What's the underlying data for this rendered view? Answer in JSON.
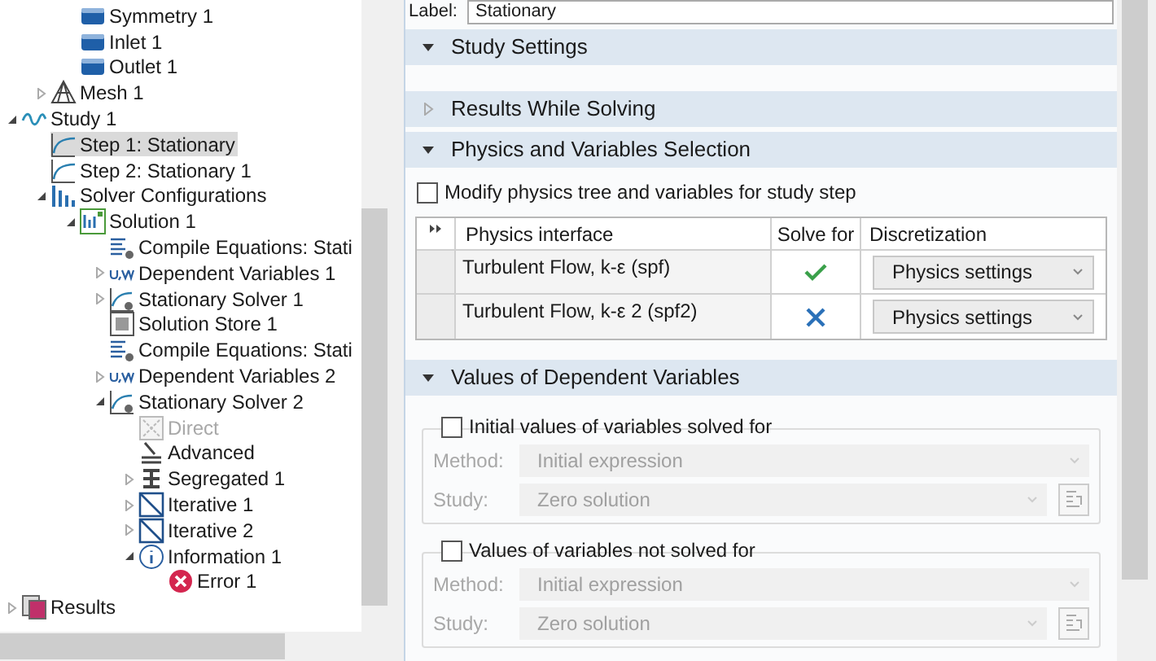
{
  "tree": [
    {
      "children": [
        {
          "children": [
            {
              "label": "Symmetry 1",
              "kind": "boundary",
              "selected": false,
              "disabled": false
            },
            {
              "label": "Inlet 1",
              "kind": "boundary",
              "selected": false,
              "disabled": false
            },
            {
              "label": "Outlet 1",
              "kind": "boundary",
              "selected": false,
              "disabled": false
            }
          ]
        },
        {
          "label": "Mesh 1",
          "kind": "mesh",
          "expanded": false,
          "selected": false,
          "disabled": false
        }
      ]
    },
    {
      "label": "Study 1",
      "kind": "study",
      "expanded": true,
      "selected": false,
      "disabled": false,
      "children": [
        {
          "label": "Step 1: Stationary",
          "kind": "step",
          "selected": true,
          "disabled": false
        },
        {
          "label": "Step 2: Stationary 1",
          "kind": "step",
          "selected": false,
          "disabled": false
        },
        {
          "label": "Solver Configurations",
          "kind": "solver-config",
          "expanded": true,
          "selected": false,
          "disabled": false,
          "children": [
            {
              "label": "Solution 1",
              "kind": "solution",
              "expanded": true,
              "selected": false,
              "disabled": false,
              "children": [
                {
                  "label": "Compile Equations: Stati",
                  "kind": "compile",
                  "selected": false,
                  "disabled": false
                },
                {
                  "label": "Dependent Variables 1",
                  "kind": "variables",
                  "expanded": false,
                  "selected": false,
                  "disabled": false
                },
                {
                  "label": "Stationary Solver 1",
                  "kind": "solver",
                  "expanded": false,
                  "selected": false,
                  "disabled": false
                },
                {
                  "label": "Solution Store 1",
                  "kind": "store",
                  "selected": false,
                  "disabled": false
                },
                {
                  "label": "Compile Equations: Stati",
                  "kind": "compile",
                  "selected": false,
                  "disabled": false
                },
                {
                  "label": "Dependent Variables 2",
                  "kind": "variables",
                  "expanded": false,
                  "selected": false,
                  "disabled": false
                },
                {
                  "label": "Stationary Solver 2",
                  "kind": "solver",
                  "expanded": true,
                  "selected": false,
                  "disabled": false,
                  "children": [
                    {
                      "label": "Direct",
                      "kind": "direct",
                      "selected": false,
                      "disabled": true
                    },
                    {
                      "label": "Advanced",
                      "kind": "advanced",
                      "selected": false,
                      "disabled": false
                    },
                    {
                      "label": "Segregated 1",
                      "kind": "segregated",
                      "expanded": false,
                      "selected": false,
                      "disabled": false
                    },
                    {
                      "label": "Iterative 1",
                      "kind": "iterative",
                      "expanded": false,
                      "selected": false,
                      "disabled": false
                    },
                    {
                      "label": "Iterative 2",
                      "kind": "iterative",
                      "expanded": false,
                      "selected": false,
                      "disabled": false
                    },
                    {
                      "label": "Information 1",
                      "kind": "information",
                      "expanded": true,
                      "selected": false,
                      "disabled": false,
                      "children": [
                        {
                          "label": "Error 1",
                          "kind": "error",
                          "selected": false,
                          "disabled": false
                        }
                      ]
                    }
                  ]
                }
              ]
            }
          ]
        }
      ]
    },
    {
      "label": "Results",
      "kind": "results",
      "expanded": false,
      "selected": false,
      "disabled": false
    }
  ],
  "settings": {
    "label_caption": "Label:",
    "label_value": "Stationary",
    "sections": [
      {
        "title": "Study Settings",
        "expanded": true,
        "kind": "empty"
      },
      {
        "title": "Results While Solving",
        "expanded": false
      },
      {
        "title": "Physics and Variables Selection",
        "expanded": true,
        "kind": "physics",
        "checkbox": {
          "label": "Modify physics tree and variables for study step",
          "checked": false
        },
        "table": {
          "columns": [
            "Physics interface",
            "Solve for",
            "Discretization"
          ],
          "rows": [
            {
              "interface": "Turbulent Flow, k-ε (spf)",
              "solve": true,
              "discretization": "Physics settings"
            },
            {
              "interface": "Turbulent Flow, k-ε 2 (spf2)",
              "solve": false,
              "discretization": "Physics settings"
            }
          ]
        }
      },
      {
        "title": "Values of Dependent Variables",
        "expanded": true,
        "kind": "values",
        "groups": [
          {
            "label": "Initial values of variables solved for",
            "checked": false,
            "fields": [
              {
                "label": "Method:",
                "value": "Initial expression",
                "kind": "select"
              },
              {
                "label": "Study:",
                "value": "Zero solution",
                "kind": "select-with-button"
              }
            ]
          },
          {
            "label": "Values of variables not solved for",
            "checked": false,
            "fields": [
              {
                "label": "Method:",
                "value": "Initial expression",
                "kind": "select"
              },
              {
                "label": "Study:",
                "value": "Zero solution",
                "kind": "select-with-button"
              }
            ]
          }
        ]
      }
    ]
  }
}
